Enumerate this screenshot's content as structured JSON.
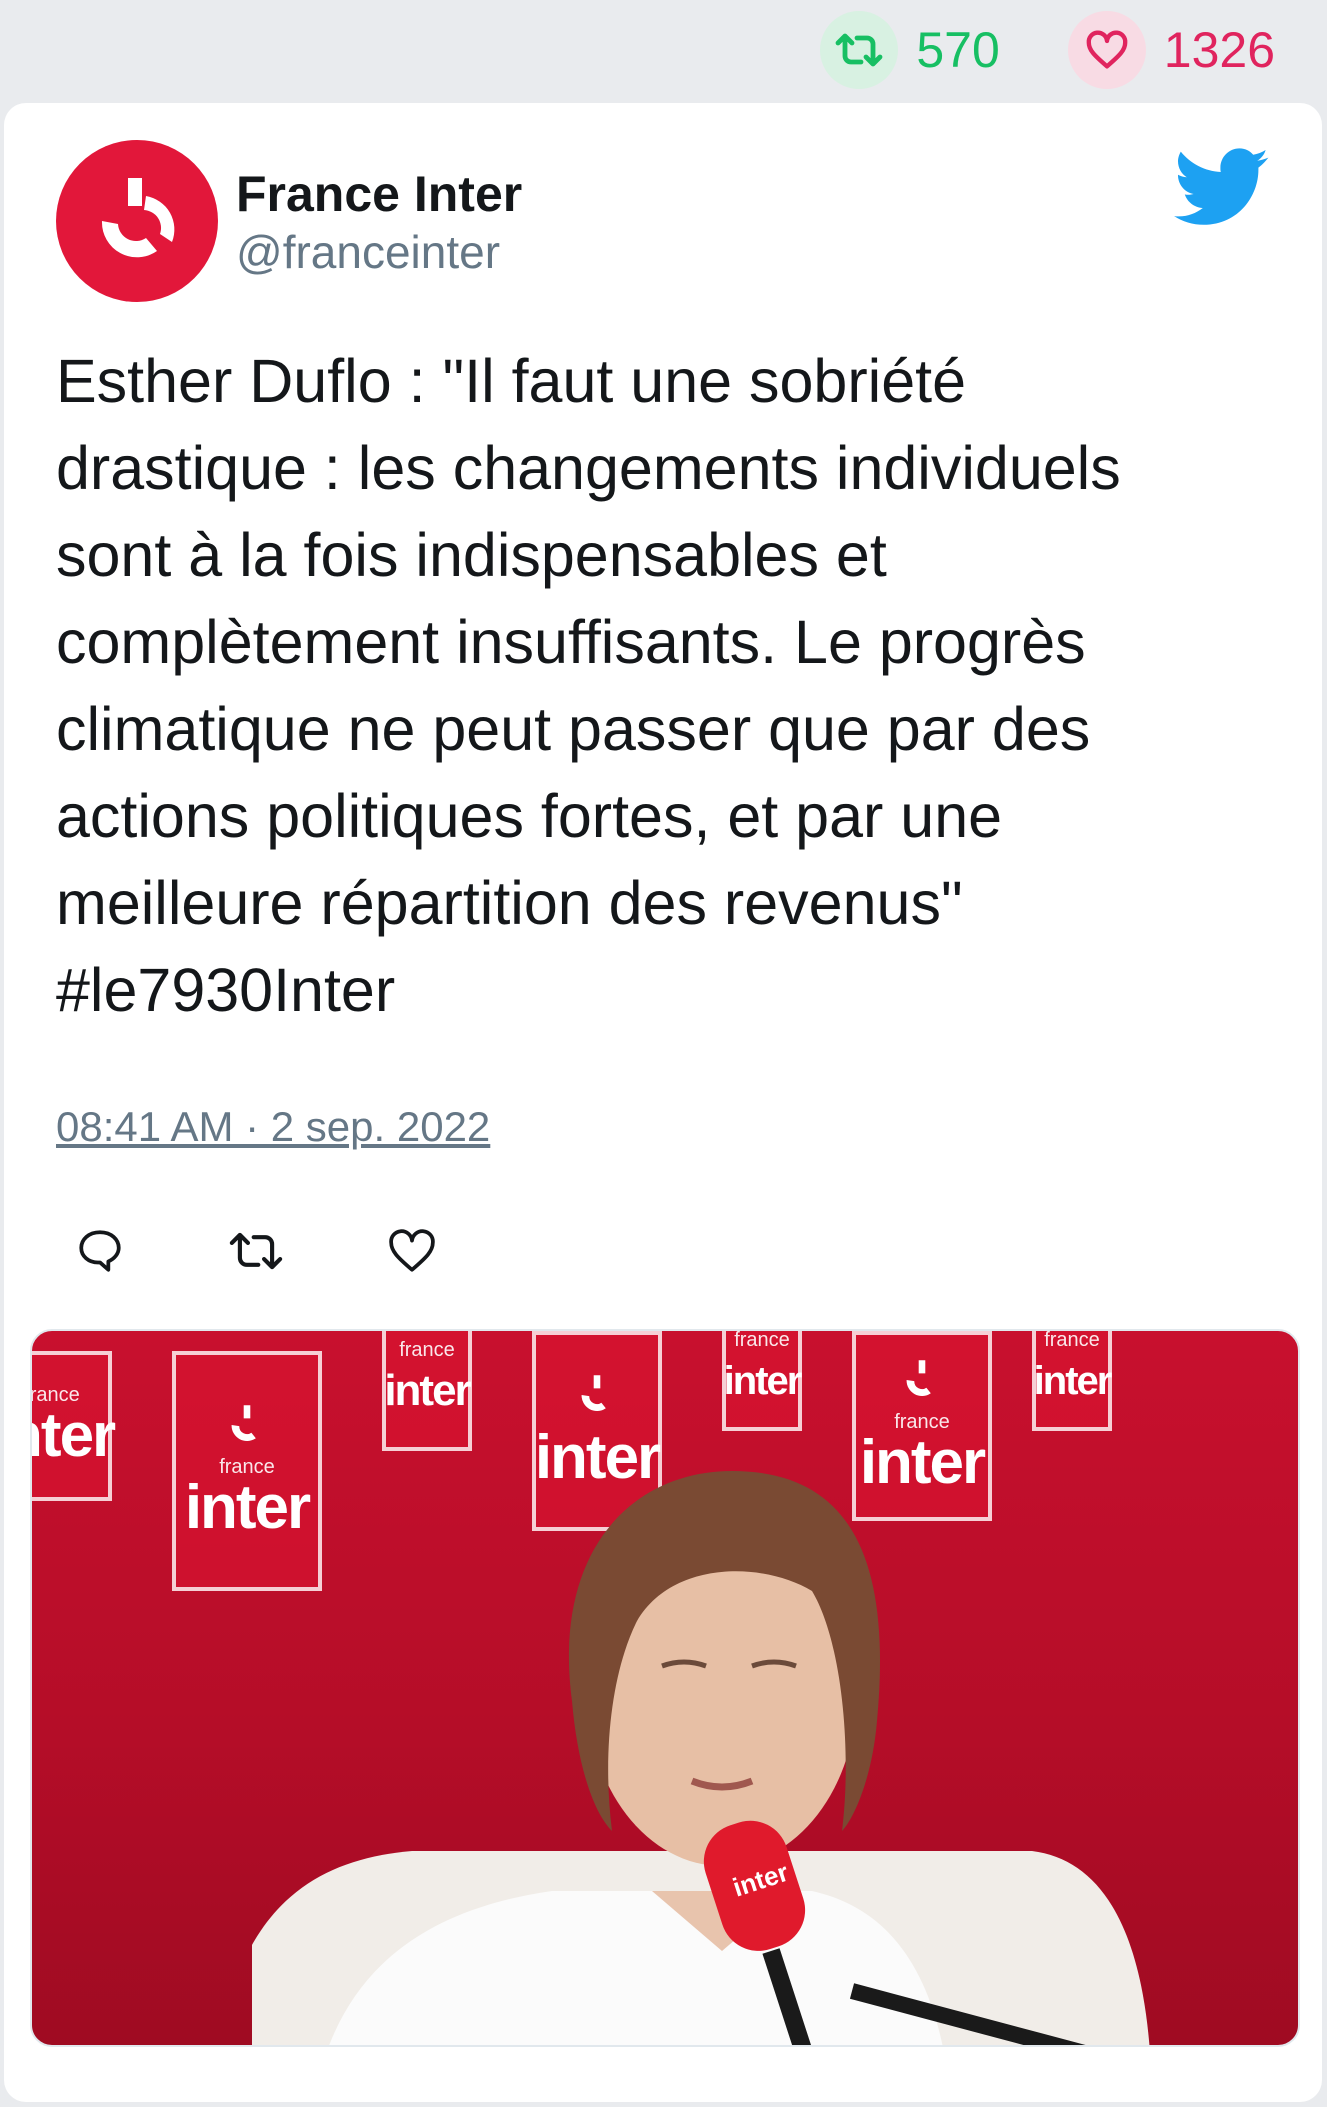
{
  "engagement": {
    "retweets": "570",
    "likes": "1326",
    "retweet_color": "#17bf63",
    "like_color": "#e0245e"
  },
  "author": {
    "name": "France Inter",
    "handle": "@franceinter",
    "avatar_color": "#e2173a"
  },
  "tweet": {
    "text": "Esther Duflo : \"Il faut une sobriété\ndrastique : les changements individuels\nsont à la fois indispensables et\ncomplètement insuffisants. Le progrès\nclimatique ne peut passer que par des\nactions politiques fortes, et par une\nmeilleure répartition des revenus\"\n#le7930Inter",
    "timestamp": "08:41 AM · 2 sep. 2022"
  },
  "actions": [
    "reply-icon",
    "retweet-icon",
    "heart-icon"
  ],
  "media": {
    "brand_small": "france",
    "brand_big": "inter",
    "mic_label": "inter",
    "background_color": "#c8102e"
  }
}
